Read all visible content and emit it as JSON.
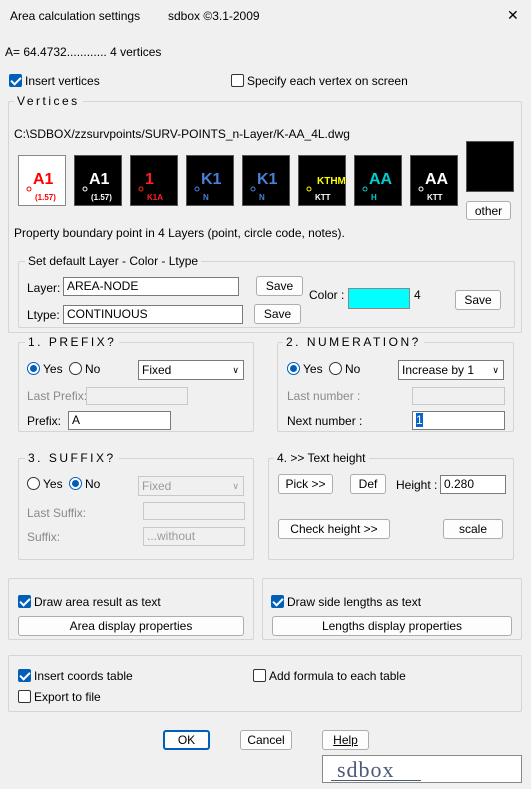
{
  "window": {
    "title": "Area calculation settings",
    "subtitle": "sdbox  ©3.1-2009",
    "close_glyph": "✕"
  },
  "area_line": "A= 64.4732............ 4 vertices",
  "insert_vertices": {
    "label": "Insert vertices",
    "checked": true
  },
  "specify_vertex": {
    "label": "Specify each vertex on screen",
    "checked": false
  },
  "vertices_group": {
    "title": "Vertices",
    "path": "C:\\SDBOX/zzsurvpoints/SURV-POINTS_n-Layer/K-AA_4L.dwg",
    "description": "Property boundary point in 4 Layers  (point, circle code, notes).",
    "other_label": "other",
    "thumbnails": [
      {
        "main": "A1",
        "sub": "(1.57)",
        "color": "#ff0000",
        "subcolor": "#ff0000",
        "bg": "#ffffff"
      },
      {
        "main": "A1",
        "sub": "(1.57)",
        "color": "#ffffff",
        "subcolor": "#ffffff",
        "bg": "#000000"
      },
      {
        "main": "1",
        "sub": "K1A",
        "color": "#ff2020",
        "subcolor": "#ff2020",
        "bg": "#000000"
      },
      {
        "main": "K1",
        "sub": "N",
        "color": "#4a7fd6",
        "subcolor": "#4a7fd6",
        "bg": "#000000"
      },
      {
        "main": "K1",
        "sub": "N",
        "color": "#4a7fd6",
        "subcolor": "#4a7fd6",
        "bg": "#000000"
      },
      {
        "main": "KTHM",
        "sub": "KTT",
        "color": "#ffff00",
        "subcolor": "#ffffff",
        "bg": "#000000"
      },
      {
        "main": "AA",
        "sub": "H",
        "color": "#00d0d0",
        "subcolor": "#00d0d0",
        "bg": "#000000"
      },
      {
        "main": "AA",
        "sub": "KTT",
        "color": "#ffffff",
        "subcolor": "#ffffff",
        "bg": "#000000"
      }
    ]
  },
  "defaults_group": {
    "title": "Set default Layer - Color - Ltype",
    "layer_label": "Layer:",
    "layer_value": "AREA-NODE",
    "ltype_label": "Ltype:",
    "ltype_value": "CONTINUOUS",
    "save_label": "Save",
    "color_label": "Color  :",
    "color_value": "#00ffff",
    "color_index": "4"
  },
  "prefix_group": {
    "title": "1. PREFIX?",
    "yes_label": "Yes",
    "no_label": "No",
    "mode": "Fixed",
    "last_label": "Last Prefix:",
    "last_value": "",
    "prefix_label": "Prefix:",
    "prefix_value": "A"
  },
  "numeration_group": {
    "title": "2. NUMERATION?",
    "yes_label": "Yes",
    "no_label": "No",
    "mode": "Increase by 1",
    "last_label": "Last number :",
    "last_value": "",
    "next_label": "Next number :",
    "next_value": "1"
  },
  "suffix_group": {
    "title": "3. SUFFIX?",
    "yes_label": "Yes",
    "no_label": "No",
    "mode": "Fixed",
    "last_label": "Last Suffix:",
    "last_value": "",
    "suffix_label": "Suffix:",
    "suffix_value": "...without"
  },
  "text_height_group": {
    "title": "4. >> Text height",
    "pick_label": "Pick >>",
    "def_label": "Def",
    "height_label": "Height  :",
    "height_value": "0.280",
    "check_label": "Check height >>",
    "scale_label": "scale"
  },
  "draw_area": {
    "label": "Draw area result as text",
    "checked": true,
    "button": "Area display properties"
  },
  "draw_lengths": {
    "label": "Draw side lengths as text",
    "checked": true,
    "button": "Lengths display properties"
  },
  "insert_coords": {
    "label": "Insert coords table",
    "checked": true
  },
  "add_formula": {
    "label": "Add formula to each table",
    "checked": false
  },
  "export_file": {
    "label": "Export to file",
    "checked": false
  },
  "footer": {
    "ok": "OK",
    "cancel": "Cancel",
    "help": "Help",
    "logo": "sdbox"
  }
}
